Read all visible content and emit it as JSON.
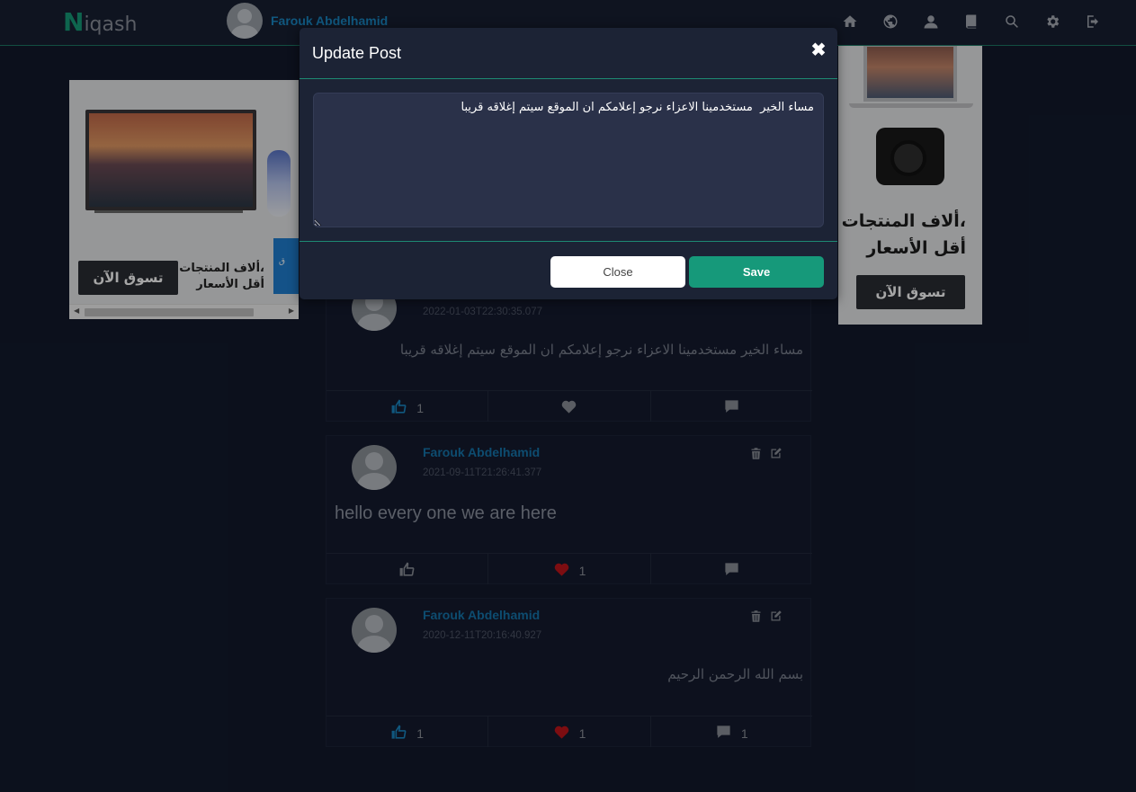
{
  "navbar": {
    "brand_first": "N",
    "brand_rest": "iqash",
    "user_name": "Farouk Abdelhamid",
    "icons": [
      "home-icon",
      "globe-icon",
      "user-icon",
      "book-icon",
      "search-icon",
      "gear-icon",
      "logout-icon"
    ]
  },
  "ads": {
    "left": {
      "button": "تسوق الآن",
      "text_line1": "ألاف المنتجات،",
      "text_line2": "أقل الأسعار",
      "logo": "ق"
    },
    "right": {
      "text_line1": "ألاف المنتجات،",
      "text_line2": "أقل الأسعار",
      "button": "تسوق الآن"
    }
  },
  "posts": [
    {
      "date": "2022-01-03T22:30:35.077",
      "body": "مساء الخير مستخدمينا الاعزاء نرجو إعلامكم ان الموقع سيتم إغلاقه قريبا",
      "likes": "1",
      "hearts": "",
      "comments": ""
    },
    {
      "author": "Farouk Abdelhamid",
      "date": "2021-09-11T21:26:41.377",
      "body": "hello every one we are here",
      "likes": "",
      "hearts": "1",
      "comments": ""
    },
    {
      "author": "Farouk Abdelhamid",
      "date": "2020-12-11T20:16:40.927",
      "body": "بسم الله الرحمن الرحيم",
      "likes": "1",
      "hearts": "1",
      "comments": "1"
    }
  ],
  "modal": {
    "title": "Update Post",
    "close_symbol": "✖",
    "textarea_value": "مساء الخير  مستخدمينا الاعزاء نرجو إعلامكم ان الموقع سيتم إغلاقه قريبا",
    "close_label": "Close",
    "save_label": "Save"
  },
  "colors": {
    "accent": "#16997a",
    "author": "#1576ad",
    "heart": "#c0151b",
    "like_active": "#1a87c4"
  }
}
